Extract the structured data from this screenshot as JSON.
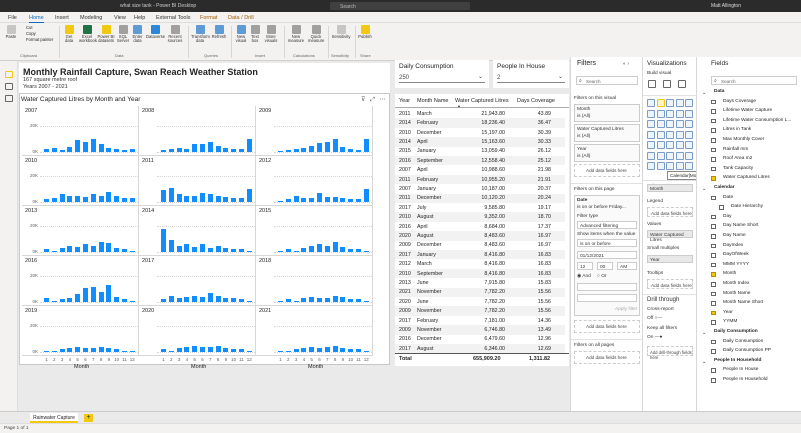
{
  "app": {
    "window_title": "what size tank - Power BI Desktop",
    "search_placeholder": "Search",
    "user": "Matt Allington"
  },
  "menu": [
    "File",
    "Home",
    "Insert",
    "Modeling",
    "View",
    "Help",
    "External Tools",
    "Format",
    "Data / Drill"
  ],
  "ribbon": {
    "buttons": [
      {
        "label": "Paste"
      },
      {
        "label": "Get data"
      },
      {
        "label": "Excel workbook"
      },
      {
        "label": "Power BI datasets"
      },
      {
        "label": "SQL Server"
      },
      {
        "label": "Enter data"
      },
      {
        "label": "Dataverse"
      },
      {
        "label": "Recent sources"
      },
      {
        "label": "Transform data"
      },
      {
        "label": "Refresh"
      },
      {
        "label": "New visual"
      },
      {
        "label": "Text box"
      },
      {
        "label": "More visuals"
      },
      {
        "label": "New measure"
      },
      {
        "label": "Quick measure"
      },
      {
        "label": "Sensitivity"
      },
      {
        "label": "Publish"
      }
    ],
    "clipboard_items": [
      "Cut",
      "Copy",
      "Format painter"
    ],
    "groups": [
      "Clipboard",
      "Data",
      "Queries",
      "Insert",
      "Calculations",
      "Sensitivity",
      "Share"
    ]
  },
  "report": {
    "title": "Monthly Rainfall Capture, Swan Reach Weather Station",
    "roof": "167 square metre roof",
    "years": "Years 2007 - 2021",
    "chart_title": "Water Captured Litres by Month and Year"
  },
  "slicers": [
    {
      "label": "Daily Consumption",
      "value": "250"
    },
    {
      "label": "People In House",
      "value": "2"
    }
  ],
  "chart_data": {
    "type": "bar",
    "title": "Water Captured Litres by Month and Year",
    "xlabel": "Month",
    "ylabel": "",
    "categories": [
      "1",
      "2",
      "3",
      "4",
      "5",
      "6",
      "7",
      "8",
      "9",
      "10",
      "11",
      "12"
    ],
    "y_ticks": [
      "20K",
      "0K"
    ],
    "ylim": [
      0,
      25000
    ],
    "small_multiples": [
      {
        "name": "2007",
        "values": [
          2000,
          3000,
          1500,
          4000,
          9000,
          8000,
          10200,
          6000,
          3000,
          2000,
          1500,
          2000
        ]
      },
      {
        "name": "2008",
        "values": [
          1500,
          2000,
          3000,
          2500,
          6000,
          6000,
          8000,
          5000,
          3000,
          2000,
          2000,
          10000
        ]
      },
      {
        "name": "2009",
        "values": [
          1000,
          1500,
          2000,
          3000,
          5000,
          7000,
          8000,
          10000,
          4000,
          2000,
          1500,
          10000
        ]
      },
      {
        "name": "2010",
        "values": [
          2000,
          3000,
          6000,
          5000,
          5000,
          4000,
          6000,
          5000,
          8000,
          5000,
          3000,
          3000
        ]
      },
      {
        "name": "2011",
        "values": [
          9000,
          11000,
          6000,
          5000,
          5000,
          7000,
          6000,
          5000,
          4000,
          3000,
          3000,
          10000
        ]
      },
      {
        "name": "2012",
        "values": [
          1000,
          2000,
          5000,
          3000,
          3000,
          7000,
          4000,
          4000,
          3000,
          2000,
          2000,
          10000
        ]
      },
      {
        "name": "2013",
        "values": [
          2000,
          1000,
          3000,
          5000,
          4000,
          6000,
          5000,
          8000,
          7000,
          3000,
          2000,
          1000
        ]
      },
      {
        "name": "2014",
        "values": [
          18000,
          9000,
          5000,
          6000,
          4000,
          6000,
          3000,
          5000,
          3000,
          2000,
          2000,
          1000
        ]
      },
      {
        "name": "2015",
        "values": [
          1000,
          2000,
          1000,
          3000,
          5000,
          6000,
          5000,
          8000,
          4000,
          2000,
          2000,
          1000
        ]
      },
      {
        "name": "2016",
        "values": [
          3000,
          1000,
          2000,
          3000,
          6000,
          11000,
          12000,
          8000,
          13000,
          4000,
          2000,
          1000
        ]
      },
      {
        "name": "2017",
        "values": [
          2000,
          5000,
          3000,
          4000,
          5000,
          4000,
          7000,
          5000,
          3000,
          3000,
          2000,
          1000
        ]
      },
      {
        "name": "2018",
        "values": [
          1000,
          2000,
          1000,
          3000,
          4000,
          3000,
          3000,
          5000,
          4000,
          2000,
          2000,
          1000
        ]
      },
      {
        "name": "2019",
        "values": [
          1000,
          1000,
          2000,
          3000,
          4000,
          3000,
          3000,
          4000,
          3000,
          2000,
          1000,
          1000
        ]
      },
      {
        "name": "2020",
        "values": [
          2000,
          1000,
          3000,
          4000,
          5000,
          4000,
          4000,
          5000,
          3000,
          2000,
          2000,
          1000
        ]
      },
      {
        "name": "2021",
        "values": [
          1000,
          1000,
          2000,
          3000,
          4000,
          3000,
          4000,
          5000,
          3000,
          2000,
          2000,
          1000
        ]
      }
    ]
  },
  "table": {
    "headers": [
      "Year",
      "Month Name",
      "Water Captured Litres",
      "Days Coverage"
    ],
    "rows": [
      [
        "2011",
        "March",
        "21,943.80",
        "43.89"
      ],
      [
        "2014",
        "February",
        "18,236.40",
        "36.47"
      ],
      [
        "2010",
        "December",
        "15,197.00",
        "30.39"
      ],
      [
        "2014",
        "April",
        "15,163.60",
        "30.33"
      ],
      [
        "2015",
        "January",
        "13,059.40",
        "26.12"
      ],
      [
        "2016",
        "September",
        "12,558.40",
        "25.12"
      ],
      [
        "2007",
        "April",
        "10,988.60",
        "21.98"
      ],
      [
        "2011",
        "February",
        "10,955.20",
        "21.91"
      ],
      [
        "2007",
        "January",
        "10,187.00",
        "20.37"
      ],
      [
        "2011",
        "December",
        "10,120.20",
        "20.24"
      ],
      [
        "2017",
        "July",
        "9,585.80",
        "19.17"
      ],
      [
        "2010",
        "August",
        "9,352.00",
        "18.70"
      ],
      [
        "2016",
        "April",
        "8,684.00",
        "17.37"
      ],
      [
        "2020",
        "August",
        "8,483.60",
        "16.97"
      ],
      [
        "2009",
        "December",
        "8,483.60",
        "16.97"
      ],
      [
        "2017",
        "January",
        "8,416.80",
        "16.83"
      ],
      [
        "2012",
        "March",
        "8,416.80",
        "16.83"
      ],
      [
        "2010",
        "September",
        "8,416.80",
        "16.83"
      ],
      [
        "2013",
        "June",
        "7,915.80",
        "15.83"
      ],
      [
        "2021",
        "November",
        "7,782.20",
        "15.56"
      ],
      [
        "2020",
        "June",
        "7,782.20",
        "15.56"
      ],
      [
        "2009",
        "November",
        "7,782.20",
        "15.56"
      ],
      [
        "2017",
        "February",
        "7,181.00",
        "14.36"
      ],
      [
        "2009",
        "November",
        "6,746.80",
        "13.49"
      ],
      [
        "2016",
        "December",
        "6,479.60",
        "12.96"
      ],
      [
        "2017",
        "August",
        "6,346.00",
        "12.69"
      ]
    ],
    "total_label": "Total",
    "total_litres": "655,909.20",
    "total_days": "1,311.82"
  },
  "filters": {
    "title": "Filters",
    "search": "Search",
    "visual_section": "Filters on this visual",
    "visual_filters": [
      {
        "name": "Month",
        "state": "is (All)"
      },
      {
        "name": "Water Captured Litres",
        "state": "is (All)"
      },
      {
        "name": "Year",
        "state": "is (All)"
      }
    ],
    "add_fields": "Add data fields here",
    "page_section": "Filters on this page",
    "date_filter": {
      "name": "Date",
      "state": "is on or before Friday...",
      "type_label": "Filter type",
      "type_value": "Advanced filtering",
      "show_label": "Show items when the value",
      "condition": "is on or before",
      "date": "01/12/2021",
      "time_h": "12",
      "time_m": "00",
      "ampm": "AM",
      "and": "And",
      "or": "Or",
      "apply": "Apply filter"
    },
    "all_pages_section": "Filters on all pages"
  },
  "visualizations": {
    "title": "Visualizations",
    "build": "Build visual",
    "tooltip": "Calendar[Month]",
    "wells": [
      {
        "label": "Axis",
        "value": "Month"
      },
      {
        "label": "Legend",
        "value": "Add data fields here"
      },
      {
        "label": "Values",
        "value": "Water Captured Litres"
      },
      {
        "label": "Small multiples",
        "value": "Year"
      },
      {
        "label": "Tooltips",
        "value": "Add data fields here"
      }
    ],
    "drill": "Drill through",
    "cross_report": "Cross-report",
    "cross_state": "Off",
    "keep_filters": "Keep all filters",
    "keep_state": "On",
    "add_drill": "Add drill-through fields here"
  },
  "fields": {
    "title": "Fields",
    "search": "Search",
    "items": [
      {
        "name": "Data",
        "level": 0,
        "checked": false,
        "table": true
      },
      {
        "name": "Days Coverage",
        "level": 1,
        "checked": false
      },
      {
        "name": "Lifetime Water Capture",
        "level": 1,
        "checked": false
      },
      {
        "name": "Lifetime Water Consumption L...",
        "level": 1,
        "checked": false
      },
      {
        "name": "Litres in Tank",
        "level": 1,
        "checked": false
      },
      {
        "name": "Max Monthly Cover",
        "level": 1,
        "checked": false
      },
      {
        "name": "Rainfall mm",
        "level": 1,
        "checked": false
      },
      {
        "name": "Roof Area m2",
        "level": 1,
        "checked": false
      },
      {
        "name": "Tank Capacity",
        "level": 1,
        "checked": false
      },
      {
        "name": "Water Captured Litres",
        "level": 1,
        "checked": true
      },
      {
        "name": "Calendar",
        "level": 0,
        "checked": false,
        "table": true
      },
      {
        "name": "Date",
        "level": 1,
        "checked": false
      },
      {
        "name": "Date Hierarchy",
        "level": 2,
        "checked": false
      },
      {
        "name": "Day",
        "level": 1,
        "checked": false
      },
      {
        "name": "Day Name Short",
        "level": 1,
        "checked": false
      },
      {
        "name": "Day Name",
        "level": 1,
        "checked": false
      },
      {
        "name": "DayIndex",
        "level": 1,
        "checked": false
      },
      {
        "name": "DayOfWeek",
        "level": 1,
        "checked": false
      },
      {
        "name": "MMM YYYY",
        "level": 1,
        "checked": false
      },
      {
        "name": "Month",
        "level": 1,
        "checked": true
      },
      {
        "name": "Month Index",
        "level": 1,
        "checked": false
      },
      {
        "name": "Month Name",
        "level": 1,
        "checked": false
      },
      {
        "name": "Month Name Short",
        "level": 1,
        "checked": false
      },
      {
        "name": "Year",
        "level": 1,
        "checked": true
      },
      {
        "name": "YYMM",
        "level": 1,
        "checked": false
      },
      {
        "name": "Daily Consumption",
        "level": 0,
        "checked": false,
        "table": true
      },
      {
        "name": "Daily Consumption",
        "level": 1,
        "checked": false
      },
      {
        "name": "Daily Consumption PP",
        "level": 1,
        "checked": false
      },
      {
        "name": "People In Household",
        "level": 0,
        "checked": false,
        "table": true
      },
      {
        "name": "People In House",
        "level": 1,
        "checked": false
      },
      {
        "name": "People In Household",
        "level": 1,
        "checked": false
      }
    ]
  },
  "tabs": {
    "page": "Rainwater Capture",
    "add": "+"
  },
  "status": {
    "page": "Page 1 of 1"
  },
  "colors": {
    "bar": "#118dff",
    "accent": "#f2c811",
    "brand_blue": "#0f6cbd"
  }
}
